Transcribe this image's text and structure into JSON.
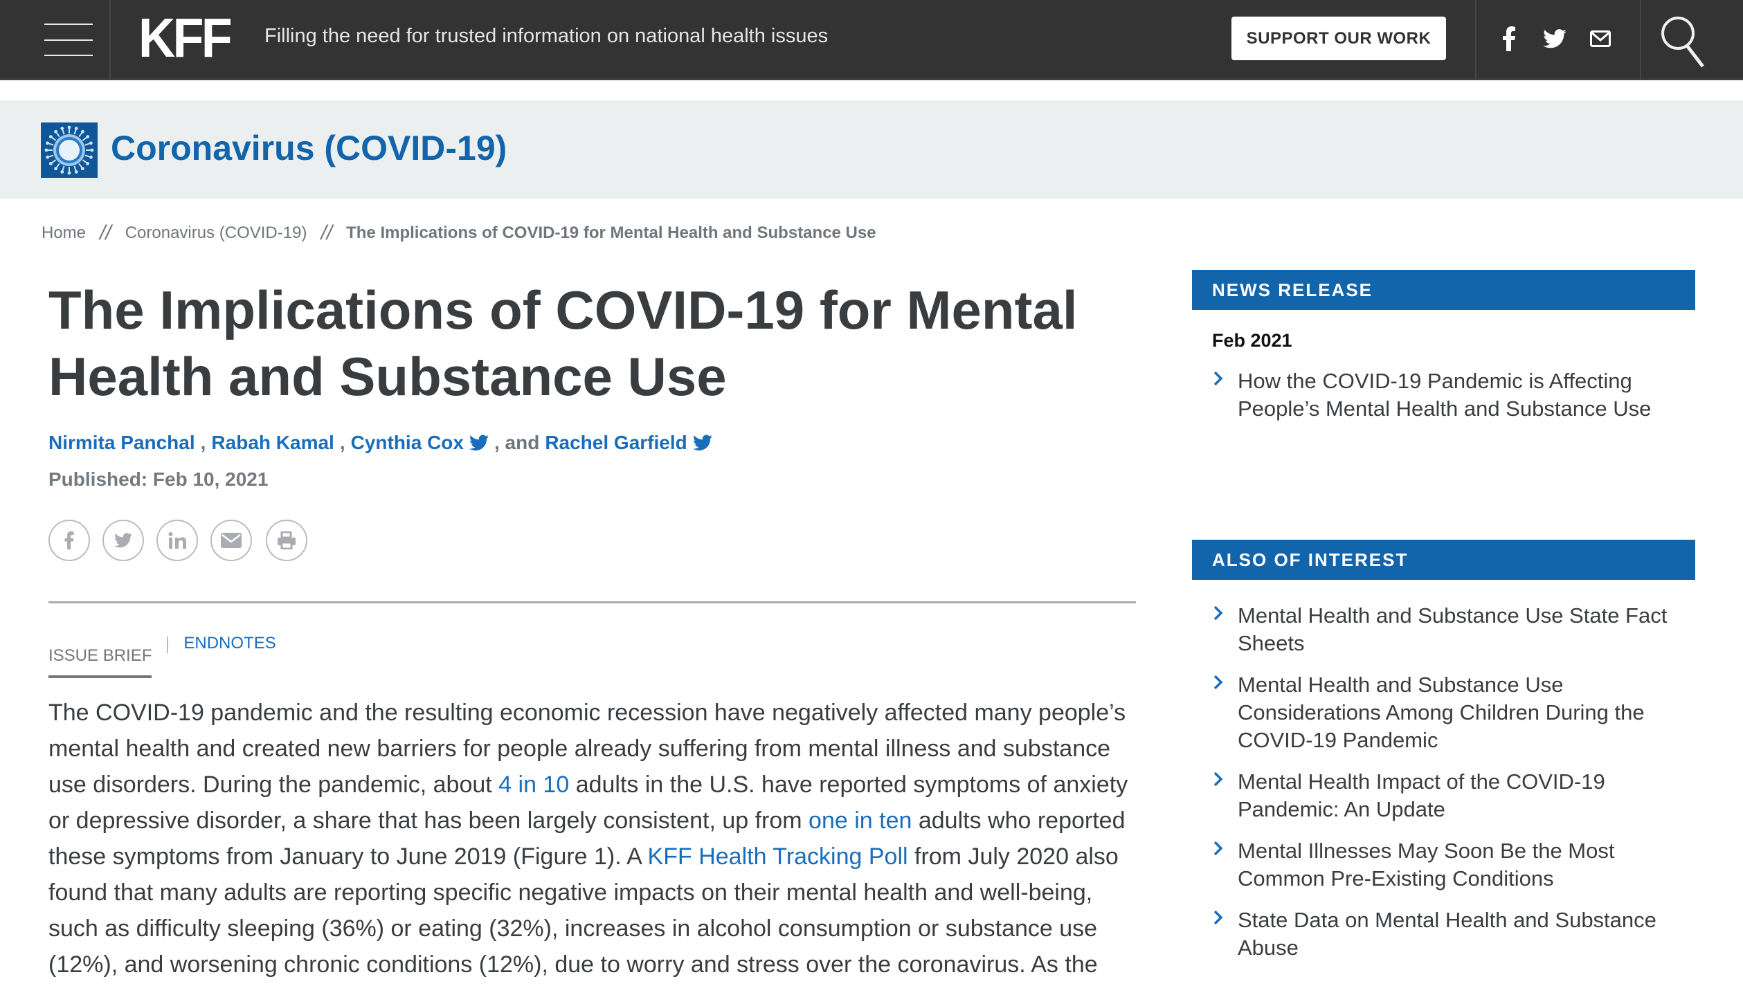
{
  "header": {
    "logo": "KFF",
    "tagline": "Filling the need for trusted information on national health issues",
    "support_label": "SUPPORT OUR WORK",
    "social_icons": [
      "facebook-icon",
      "twitter-icon",
      "email-icon"
    ],
    "search_icon": "search-icon",
    "menu_icon": "hamburger-menu-icon"
  },
  "banner": {
    "title": "Coronavirus (COVID-19)",
    "icon": "coronavirus-icon"
  },
  "breadcrumb": {
    "items": [
      "Home",
      "Coronavirus (COVID-19)",
      "The Implications of COVID-19 for Mental Health and Substance Use"
    ],
    "separator": "//"
  },
  "article": {
    "title_line1": "The Implications of COVID-19 for Mental",
    "title_line2": "Health and Substance Use",
    "authors": [
      {
        "name": "Nirmita Panchal",
        "twitter": false
      },
      {
        "name": "Rabah Kamal",
        "twitter": false
      },
      {
        "name": "Cynthia Cox",
        "twitter": true
      },
      {
        "name": "Rachel Garfield",
        "twitter": true
      }
    ],
    "author_sep": ",",
    "author_and": ", and",
    "published": "Published: Feb 10, 2021",
    "share_icons": [
      "facebook-icon",
      "twitter-icon",
      "linkedin-icon",
      "email-icon",
      "print-icon"
    ],
    "tabs": [
      {
        "label": "ISSUE BRIEF",
        "active": true
      },
      {
        "label": "ENDNOTES",
        "active": false
      }
    ],
    "body": {
      "p1": "The COVID-19 pandemic and the resulting economic recession have negatively affected many people’s mental health and created new barriers for people already suffering from mental illness and substance use disorders. During the pandemic, about ",
      "link1": "4 in 10",
      "p2": " adults in the U.S. have reported symptoms of anxiety or depressive disorder, a share that has been largely consistent, up from ",
      "link2": "one in ten",
      "p3": " adults who reported these symptoms from January to June 2019 (Figure 1). A ",
      "link3": "KFF Health Tracking Poll",
      "p4": " from July 2020 also found that many adults are reporting specific negative impacts on their mental health and well-being, such as difficulty sleeping (36%) or eating (32%), increases in alcohol consumption or substance use (12%), and worsening chronic conditions (12%), due to worry and stress over the coronavirus. As the"
    }
  },
  "sidebar": {
    "news_release": {
      "heading": "NEWS RELEASE",
      "date": "Feb 2021",
      "items": [
        "How the COVID-19 Pandemic is Affecting People’s Mental Health and Substance Use"
      ]
    },
    "also_of_interest": {
      "heading": "ALSO OF INTEREST",
      "items": [
        "Mental Health and Substance Use State Fact Sheets",
        "Mental Health and Substance Use Considerations Among Children During the COVID-19 Pandemic",
        "Mental Health Impact of the COVID-19 Pandemic: An Update",
        "Mental Illnesses May Soon Be the Most Common Pre-Existing Conditions",
        "State Data on Mental Health and Substance Abuse"
      ]
    }
  },
  "colors": {
    "header_bg": "#333333",
    "banner_bg": "#ECEFF0",
    "brand_blue": "#1264ab",
    "link_blue": "#1a6dbb",
    "text": "#3a3d40",
    "muted": "#6f767c"
  }
}
